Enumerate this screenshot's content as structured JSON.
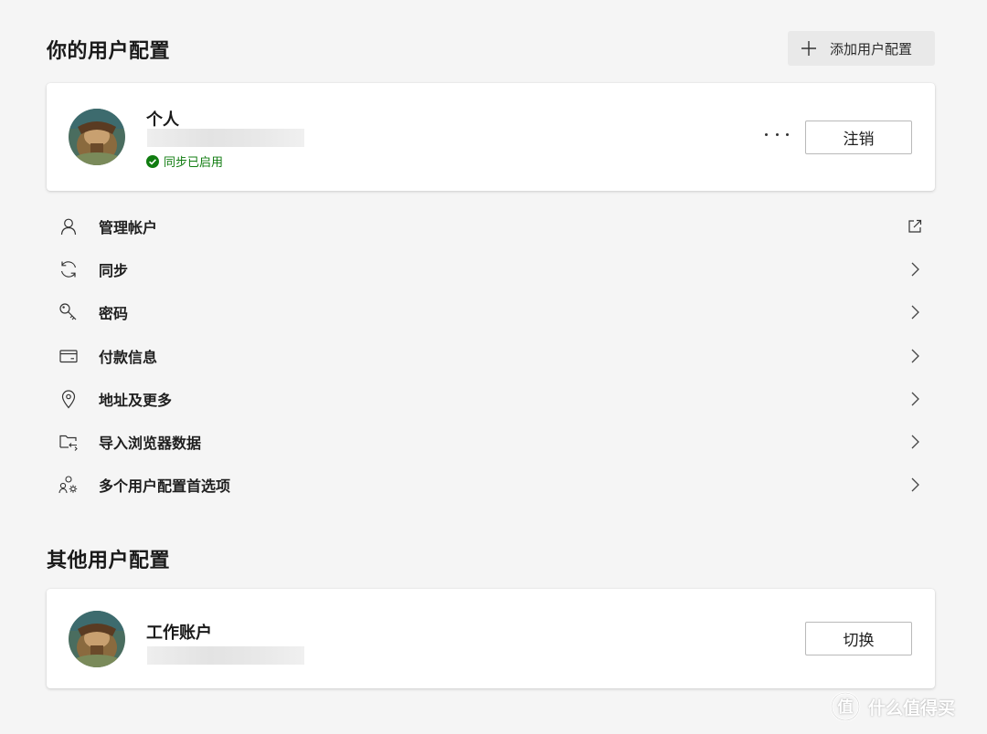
{
  "sections": {
    "your_profiles_title": "你的用户配置",
    "other_profiles_title": "其他用户配置"
  },
  "header": {
    "add_profile_label": "添加用户配置"
  },
  "current_profile": {
    "name": "个人",
    "sync_status": "同步已启用",
    "more_label": "...",
    "sign_out_label": "注销"
  },
  "menu": {
    "items": [
      {
        "label": "管理帐户",
        "icon": "person-icon",
        "trailing": "external-link-icon"
      },
      {
        "label": "同步",
        "icon": "sync-icon",
        "trailing": "chevron-right-icon"
      },
      {
        "label": "密码",
        "icon": "key-icon",
        "trailing": "chevron-right-icon"
      },
      {
        "label": "付款信息",
        "icon": "credit-card-icon",
        "trailing": "chevron-right-icon"
      },
      {
        "label": "地址及更多",
        "icon": "location-pin-icon",
        "trailing": "chevron-right-icon"
      },
      {
        "label": "导入浏览器数据",
        "icon": "import-folder-icon",
        "trailing": "chevron-right-icon"
      },
      {
        "label": "多个用户配置首选项",
        "icon": "multi-profile-settings-icon",
        "trailing": "chevron-right-icon"
      }
    ]
  },
  "other_profile": {
    "name": "工作账户",
    "switch_label": "切换"
  },
  "watermark": {
    "logo_glyph": "值",
    "text": "什么值得买"
  },
  "colors": {
    "background": "#f5f5f5",
    "card": "#ffffff",
    "sync_green": "#107c10",
    "add_button_bg": "#e9e9e9"
  }
}
